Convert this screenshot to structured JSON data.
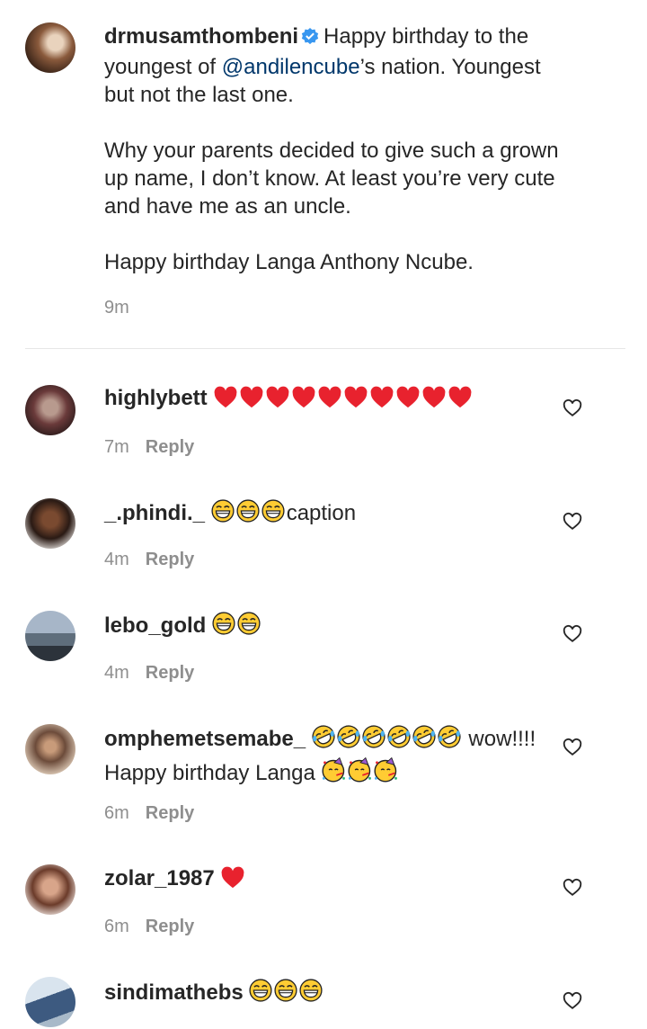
{
  "caption": {
    "username": "drmusamthombeni",
    "text_before": "Happy birthday to the youngest of ",
    "mention": "@andilencube",
    "text_after": "’s nation. Youngest but not the last one.\n\nWhy your parents decided to give such a grown up name, I don’t know. At least you’re very cute and have me as an uncle.\n\nHappy birthday Langa Anthony Ncube.",
    "time": "9m"
  },
  "comments": [
    {
      "username": "highlybett",
      "text": "",
      "time": "7m",
      "reply": "Reply"
    },
    {
      "username": "_.phindi._",
      "text": "caption",
      "time": "4m",
      "reply": "Reply"
    },
    {
      "username": "lebo_gold",
      "text": "",
      "time": "4m",
      "reply": "Reply"
    },
    {
      "username": "omphemetsemabe_",
      "text": " wow!!!!",
      "text2": "Happy birthday Langa ",
      "time": "6m",
      "reply": "Reply"
    },
    {
      "username": "zolar_1987",
      "text": "",
      "time": "6m",
      "reply": "Reply"
    },
    {
      "username": "sindimathebs",
      "text": "",
      "time": "",
      "reply": ""
    }
  ],
  "colors": {
    "heart_red": "#e8222e",
    "mention": "#00376b",
    "verified": "#3897f0",
    "meta": "#8e8e8e"
  },
  "icons": [
    "verified-badge-icon",
    "red-heart-emoji",
    "laughing-emoji",
    "rofl-emoji",
    "party-face-emoji",
    "like-heart-icon"
  ]
}
